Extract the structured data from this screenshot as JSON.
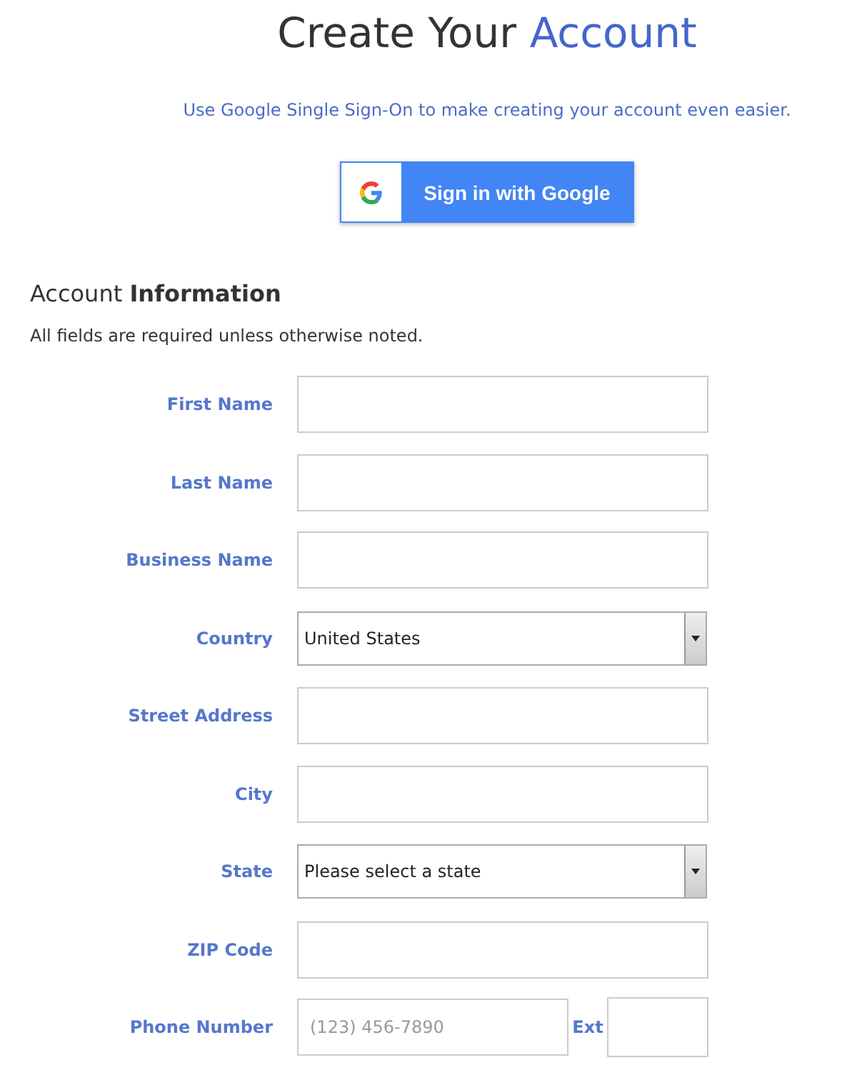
{
  "title": {
    "lead": "Create Your",
    "accent": "Account"
  },
  "sso_note": "Use Google Single Sign-On to make creating your account even easier.",
  "google_button": {
    "label": "Sign in with Google"
  },
  "section": {
    "heading": "Account **Information**",
    "note": "All fields are required unless otherwise noted."
  },
  "fields": [
    {
      "label": "First Name",
      "kind": "text"
    },
    {
      "label": "Last Name",
      "kind": "text"
    },
    {
      "label": "Business Name",
      "kind": "text"
    },
    {
      "label": "Country",
      "kind": "select",
      "value": "United States"
    },
    {
      "label": "Street Address",
      "kind": "text"
    },
    {
      "label": "City",
      "kind": "text"
    },
    {
      "label": "State",
      "kind": "select",
      "value": "Please select a state"
    },
    {
      "label": "ZIP Code",
      "kind": "text"
    },
    {
      "label": "Phone Number",
      "kind": "phone",
      "placeholder": "(123) 456-7890",
      "ext_label": "Ext"
    }
  ]
}
